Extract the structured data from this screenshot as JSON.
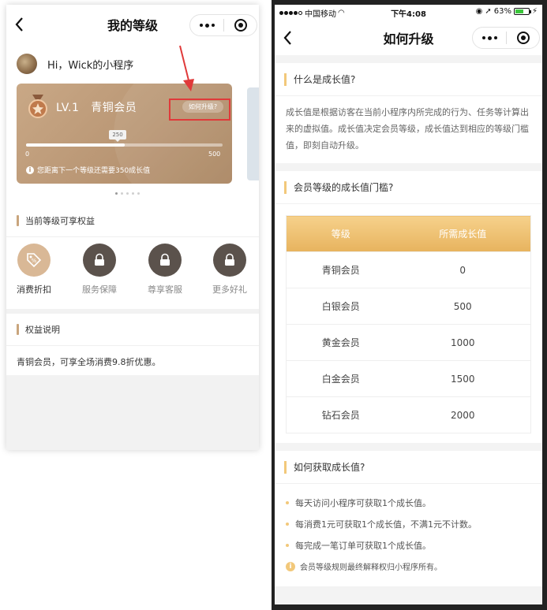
{
  "left": {
    "nav": {
      "title": "我的等级"
    },
    "user": {
      "greeting": "Hi，Wick的小程序"
    },
    "card": {
      "level": "LV.1",
      "level_name": "青铜会员",
      "how_button": "如何升级?",
      "progress_label": "250",
      "progress_fraction": 0.5,
      "min_label": "0",
      "max_label": "500",
      "note": "您距离下一个等级还需要350成长值"
    },
    "benefits_section": {
      "title": "当前等级可享权益",
      "items": [
        {
          "label": "消费折扣",
          "icon": "discount-tag-icon",
          "active": true
        },
        {
          "label": "服务保障",
          "icon": "lock-icon",
          "active": false
        },
        {
          "label": "尊享客服",
          "icon": "lock-icon",
          "active": false
        },
        {
          "label": "更多好礼",
          "icon": "lock-icon",
          "active": false
        }
      ]
    },
    "desc_section": {
      "title": "权益说明",
      "text": "青铜会员，可享全场消费9.8折优惠。"
    }
  },
  "right": {
    "status": {
      "carrier": "中国移动",
      "time": "下午4:08",
      "battery": "63%"
    },
    "nav": {
      "title": "如何升级"
    },
    "what": {
      "title": "什么是成长值?",
      "text": "成长值是根据访客在当前小程序内所完成的行为、任务等计算出来的虚拟值。成长值决定会员等级，成长值达到相应的等级门槛值，即刻自动升级。"
    },
    "threshold": {
      "title": "会员等级的成长值门槛?",
      "headers": [
        "等级",
        "所需成长值"
      ],
      "rows": [
        [
          "青铜会员",
          "0"
        ],
        [
          "白银会员",
          "500"
        ],
        [
          "黄金会员",
          "1000"
        ],
        [
          "白金会员",
          "1500"
        ],
        [
          "钻石会员",
          "2000"
        ]
      ]
    },
    "how": {
      "title": "如何获取成长值?",
      "items": [
        "每天访问小程序可获取1个成长值。",
        "每消费1元可获取1个成长值，不满1元不计数。",
        "每完成一笔订单可获取1个成长值。"
      ],
      "note": "会员等级规则最终解释权归小程序所有。"
    }
  },
  "colors": {
    "accent_gold": "#f2c87a",
    "card_bronze": "#b99674",
    "annotation_red": "#e03a3a"
  }
}
